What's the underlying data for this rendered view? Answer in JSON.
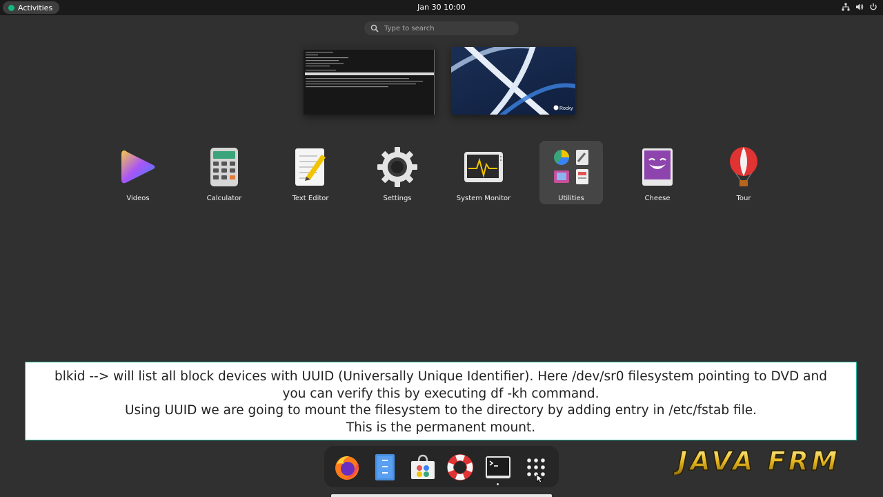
{
  "topbar": {
    "activities_label": "Activities",
    "clock": "Jan 30  10:00"
  },
  "search": {
    "placeholder": "Type to search"
  },
  "apps": [
    {
      "label": "Videos",
      "icon": "videos-icon"
    },
    {
      "label": "Calculator",
      "icon": "calculator-icon"
    },
    {
      "label": "Text Editor",
      "icon": "text-editor-icon"
    },
    {
      "label": "Settings",
      "icon": "gear-icon"
    },
    {
      "label": "System Monitor",
      "icon": "system-monitor-icon"
    },
    {
      "label": "Utilities",
      "icon": "utilities-folder-icon"
    },
    {
      "label": "Cheese",
      "icon": "cheese-icon"
    },
    {
      "label": "Tour",
      "icon": "balloon-icon"
    }
  ],
  "caption": {
    "lines": [
      "blkid --> will list all block devices with UUID (Universally Unique Identifier). Here /dev/sr0 filesystem pointing to DVD and",
      "you can verify this by executing df -kh command.",
      "Using UUID we are going to mount the filesystem to the directory by adding entry in /etc/fstab file.",
      "This is the permanent mount."
    ]
  },
  "dock": [
    "firefox-icon",
    "files-icon",
    "software-icon",
    "help-icon",
    "terminal-icon",
    "app-grid-icon"
  ],
  "desktop_thumb": {
    "brand": "Rocky"
  },
  "logo": {
    "text": "JAVA FRM"
  }
}
